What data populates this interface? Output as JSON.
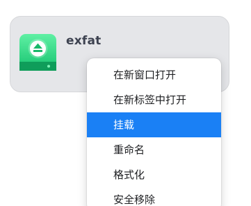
{
  "drive": {
    "name": "exfat",
    "icon": "eject-drive-icon",
    "icon_colors": {
      "top": "#55ea9a",
      "bottom": "#13c36d",
      "base": "#0e9e58"
    }
  },
  "context_menu": {
    "items": [
      {
        "label": "在新窗口打开",
        "name": "open-in-new-window"
      },
      {
        "label": "在新标签中打开",
        "name": "open-in-new-tab"
      },
      {
        "label": "挂载",
        "name": "mount",
        "active": true
      },
      {
        "label": "重命名",
        "name": "rename"
      },
      {
        "label": "格式化",
        "name": "format"
      },
      {
        "label": "安全移除",
        "name": "safely-remove"
      }
    ]
  },
  "colors": {
    "highlight": "#1a80f5",
    "card_background": "#e5e6e9"
  }
}
